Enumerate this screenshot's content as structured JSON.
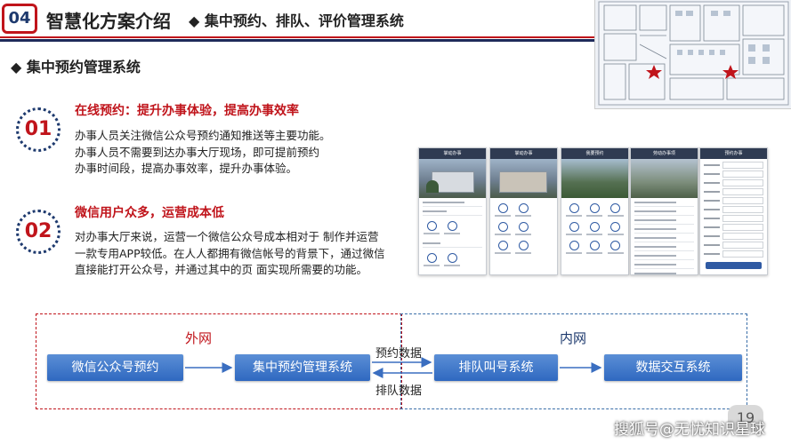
{
  "header": {
    "badge": "04",
    "title": "智慧化方案介绍",
    "subtitle": "◆ 集中预约、排队、评价管理系统"
  },
  "section": {
    "title": "◆ 集中预约管理系统"
  },
  "items": [
    {
      "number": "01",
      "title": "在线预约：提升办事体验，提高办事效率",
      "lines": [
        "办事人员关注微信公众号预约通知推送等主要功能。",
        "办事人员不需要到达办事大厅现场，即可提前预约",
        "办事时间段，提高办事效率，提升办事体验。"
      ]
    },
    {
      "number": "02",
      "title": "微信用户众多，运营成本低",
      "lines": [
        "对办事大厅来说，运营一个微信公众号成本相对于 制作并运营",
        "一款专用APP较低。在人人都拥有微信帐号的背景下，通过微信",
        "直接能打开公众号，并通过其中的页 面实现所需要的功能。"
      ]
    }
  ],
  "phones": [
    {
      "title": "掌动办事"
    },
    {
      "title": "掌动办事"
    },
    {
      "title": "我要预约"
    },
    {
      "title": "劳动办事项"
    },
    {
      "title": "预约办事"
    }
  ],
  "diagram": {
    "outer_label": "外网",
    "inner_label": "内网",
    "nodes": [
      "微信公众号预约",
      "集中预约管理系统",
      "排队叫号系统",
      "数据交互系统"
    ],
    "arrow_top": "预约数据",
    "arrow_bottom": "排队数据"
  },
  "page_number": "19",
  "watermark": "搜狐号@无忧知识星球",
  "colors": {
    "accent_red": "#c0141b",
    "navy": "#1e3a6e",
    "flow_blue": "#2f68c0"
  }
}
